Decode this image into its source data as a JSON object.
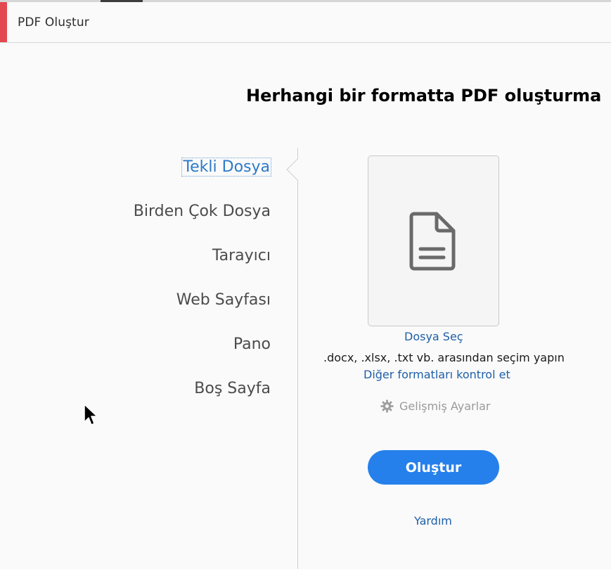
{
  "window": {
    "title": "PDF Oluştur"
  },
  "main": {
    "heading": "Herhangi bir formatta PDF oluşturma"
  },
  "nav": {
    "items": [
      {
        "label": "Tekli Dosya",
        "active": true
      },
      {
        "label": "Birden Çok Dosya",
        "active": false
      },
      {
        "label": "Tarayıcı",
        "active": false
      },
      {
        "label": "Web Sayfası",
        "active": false
      },
      {
        "label": "Pano",
        "active": false
      },
      {
        "label": "Boş Sayfa",
        "active": false
      }
    ]
  },
  "panel": {
    "select_file": "Dosya Seç",
    "hint": ".docx, .xlsx, .txt vb. arasından seçim yapın",
    "other_formats": "Diğer formatları kontrol et",
    "advanced_settings": "Gelişmiş Ayarlar",
    "create_button": "Oluştur",
    "help": "Yardım"
  },
  "icons": {
    "document": "document-icon",
    "gear": "gear-icon",
    "cursor": "mouse-cursor-icon"
  },
  "colors": {
    "accent_red": "#e34850",
    "primary_blue": "#2680eb",
    "link_blue": "#1f5fa8",
    "active_nav_blue": "#2d7ac9"
  }
}
